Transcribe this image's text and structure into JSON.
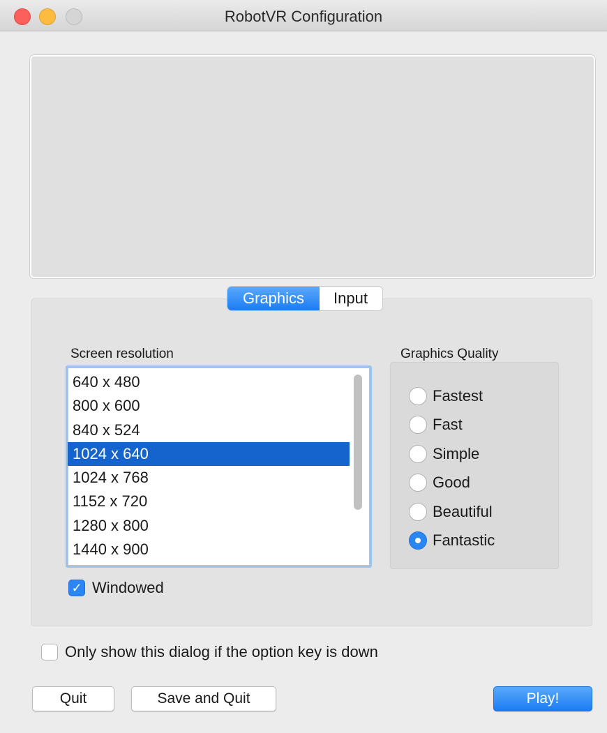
{
  "window": {
    "title": "RobotVR Configuration",
    "colors": {
      "close": "#fc605c",
      "minimize": "#fdbc40",
      "maximize": "#d5d5d5",
      "accent": "#1b7cf3",
      "selection": "#1563cc"
    }
  },
  "tabs": [
    {
      "label": "Graphics",
      "active": true
    },
    {
      "label": "Input",
      "active": false
    }
  ],
  "graphics": {
    "resolution_label": "Screen resolution",
    "resolutions": [
      "640 x 480",
      "800 x 600",
      "840 x 524",
      "1024 x 640",
      "1024 x 768",
      "1152 x 720",
      "1280 x 800",
      "1440 x 900"
    ],
    "selected_resolution": "1024 x 640",
    "quality_label": "Graphics Quality",
    "qualities": [
      "Fastest",
      "Fast",
      "Simple",
      "Good",
      "Beautiful",
      "Fantastic"
    ],
    "selected_quality": "Fantastic",
    "windowed": {
      "label": "Windowed",
      "checked": true
    }
  },
  "option_key": {
    "label": "Only show this dialog if the option key is down",
    "checked": false
  },
  "buttons": {
    "quit": "Quit",
    "save_quit": "Save and Quit",
    "play": "Play!"
  }
}
